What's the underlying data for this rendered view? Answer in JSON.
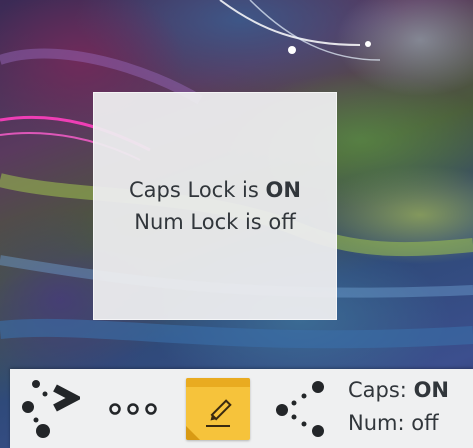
{
  "osd": {
    "caps_prefix": "Caps Lock is",
    "caps_state": "ON",
    "num_prefix": "Num Lock is",
    "num_state": "off"
  },
  "panel": {
    "icons": [
      "kde-connect-icon",
      "more-dots-icon",
      "sticky-notes-icon",
      "share-icon"
    ],
    "caps_label": "Caps:",
    "caps_state": "ON",
    "num_label": "Num:",
    "num_state": "off"
  },
  "colors": {
    "panel_bg": "#eff0f1",
    "text": "#31363b",
    "notes_yellow": "#f6c33b",
    "icon_dark": "#232629"
  }
}
